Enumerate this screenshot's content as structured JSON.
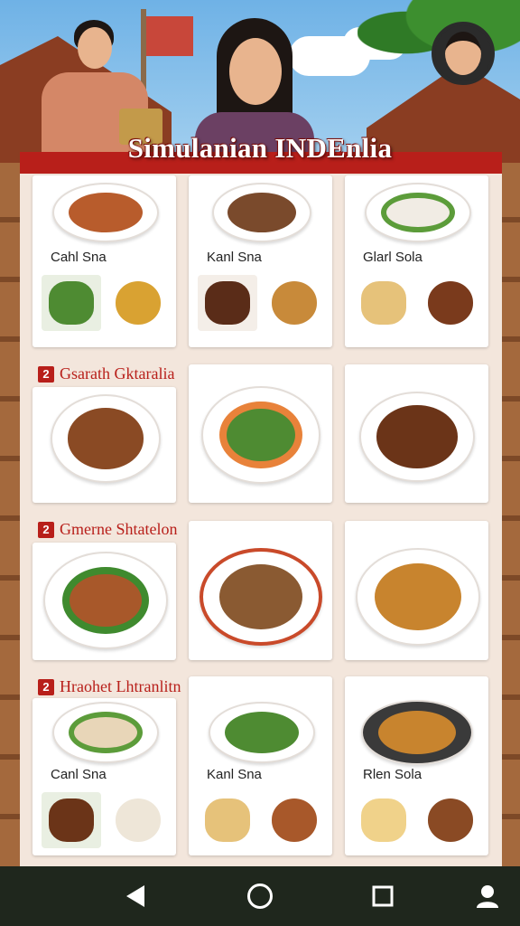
{
  "app": {
    "title": "Simulanian INDEnlia"
  },
  "sections": [
    {
      "number": "2",
      "title": "Gsarath Gktaralia"
    },
    {
      "number": "2",
      "title": "Gmerne Shtatelon"
    },
    {
      "number": "2",
      "title": "Hraohet Lhtranlitn"
    }
  ],
  "top_row": [
    {
      "label": "Cahl Sna"
    },
    {
      "label": "Kanl Sna"
    },
    {
      "label": "Glarl Sola"
    }
  ],
  "bottom_row": [
    {
      "label": "Canl Sna"
    },
    {
      "label": "Kanl Sna"
    },
    {
      "label": "Rlen Sola"
    }
  ],
  "colors": {
    "accent": "#b81f1a",
    "panel": "#f3e6dc",
    "navbar": "#1f271d"
  },
  "nav": [
    "back-icon",
    "home-icon",
    "recents-icon",
    "profile-icon"
  ]
}
